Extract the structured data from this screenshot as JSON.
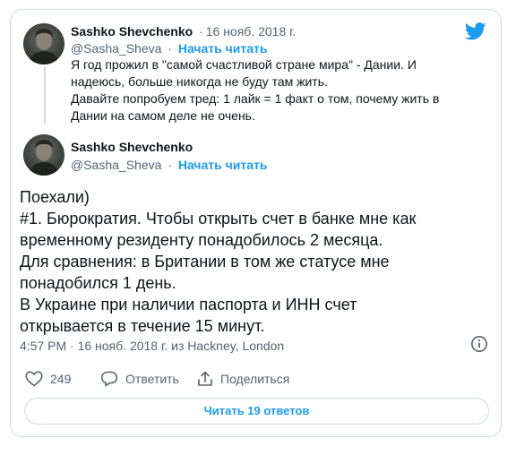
{
  "quoted_tweet": {
    "author_name": "Sashko Shevchenko",
    "date": "16 нояб. 2018 г.",
    "handle": "@Sasha_Sheva",
    "follow_label": "Начать читать",
    "text_lines": [
      "Я год прожил в \"самой счастливой стране мира\" - Дании. И",
      "надеюсь, больше никогда не буду там жить.",
      "Давайте попробуем тред: 1 лайк = 1 факт о том, почему жить в",
      "Дании на самом деле не очень."
    ]
  },
  "main_tweet": {
    "author_name": "Sashko Shevchenko",
    "handle": "@Sasha_Sheva",
    "follow_label": "Начать читать",
    "text_lines": [
      "Поехали)",
      "#1. Бюрократия. Чтобы открыть счет в банке мне как",
      "временному резиденту понадобилось 2 месяца.",
      "Для сравнения: в Британии в том же статусе мне",
      "понадобился 1 день.",
      "В Украине при наличии паспорта и ИНН счет",
      "открывается в течение 15 минут."
    ],
    "timestamp": "4:57 PM · 16 нояб. 2018 г. из Hackney, London"
  },
  "actions": {
    "like_count": "249",
    "reply_label": "Ответить",
    "share_label": "Поделиться"
  },
  "read_replies_label": "Читать 19 ответов",
  "icons": {
    "brand": "twitter-bird-icon",
    "info": "info-icon",
    "like": "heart-icon",
    "reply": "speech-bubble-icon",
    "share": "share-icon"
  },
  "colors": {
    "accent": "#1d9bf0",
    "secondary_text": "#536471",
    "border": "#cfd9de"
  }
}
